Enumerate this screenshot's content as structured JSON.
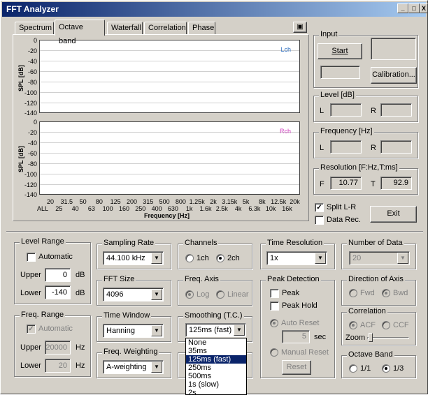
{
  "window": {
    "title": "FFT Analyzer",
    "min": "_",
    "max": "□",
    "close": "X"
  },
  "tabs": [
    "Spectrum",
    "Octave band",
    "Waterfall",
    "Correlation",
    "Phase"
  ],
  "plot": {
    "ylabel": "SPL [dB]",
    "yticks": [
      "0",
      "-20",
      "-40",
      "-60",
      "-80",
      "-100",
      "-120",
      "-140"
    ],
    "lch": "Lch",
    "rch": "Rch",
    "xticks_top": [
      "20",
      "31.5",
      "50",
      "80",
      "125",
      "200",
      "315",
      "500",
      "800",
      "1.25k",
      "2k",
      "3.15k",
      "5k",
      "8k",
      "12.5k",
      "20k"
    ],
    "xticks_bottom": [
      "ALL",
      "25",
      "40",
      "63",
      "100",
      "160",
      "250",
      "400",
      "630",
      "1k",
      "1.6k",
      "2.5k",
      "4k",
      "6.3k",
      "10k",
      "16k"
    ],
    "xlabel": "Frequency [Hz]"
  },
  "input": {
    "title": "Input",
    "start": "Start",
    "calibration": "Calibration..."
  },
  "level": {
    "title": "Level [dB]",
    "l": "L",
    "r": "R"
  },
  "frequency": {
    "title": "Frequency [Hz]",
    "l": "L",
    "r": "R"
  },
  "resolution": {
    "title": "Resolution [F:Hz,T:ms]",
    "f": "F",
    "f_val": "10.77",
    "t": "T",
    "t_val": "92.9"
  },
  "split": "Split L-R",
  "datarec": "Data Rec.",
  "exit": "Exit",
  "level_range": {
    "title": "Level Range",
    "automatic": "Automatic",
    "upper": "Upper",
    "upper_val": "0",
    "lower": "Lower",
    "lower_val": "-140",
    "unit": "dB"
  },
  "freq_range": {
    "title": "Freq. Range",
    "automatic": "Automatic",
    "upper": "Upper",
    "upper_val": "20000",
    "lower": "Lower",
    "lower_val": "20",
    "unit": "Hz"
  },
  "sampling": {
    "title": "Sampling Rate",
    "value": "44.100 kHz"
  },
  "fft_size": {
    "title": "FFT Size",
    "value": "4096"
  },
  "time_window": {
    "title": "Time Window",
    "value": "Hanning"
  },
  "freq_weighting": {
    "title": "Freq. Weighting",
    "value": "A-weighting"
  },
  "channels": {
    "title": "Channels",
    "opt1": "1ch",
    "opt2": "2ch"
  },
  "freq_axis": {
    "title": "Freq. Axis",
    "opt1": "Log",
    "opt2": "Linear"
  },
  "smoothing": {
    "title": "Smoothing (T.C.)",
    "value": "125ms (fast)",
    "options": [
      "None",
      "35ms",
      "125ms (fast)",
      "250ms",
      "500ms",
      "1s (slow)",
      "2s"
    ]
  },
  "time_res": {
    "title": "Time Resolution",
    "value": "1x"
  },
  "peak": {
    "title": "Peak Detection",
    "peak": "Peak",
    "hold": "Peak Hold",
    "auto": "Auto Reset",
    "sec_val": "5",
    "sec": "sec",
    "manual": "Manual Reset",
    "reset": "Reset"
  },
  "num_data": {
    "title": "Number of Data",
    "value": "20"
  },
  "direction": {
    "title": "Direction of Axis",
    "fwd": "Fwd",
    "bwd": "Bwd"
  },
  "correlation": {
    "title": "Correlation",
    "acf": "ACF",
    "ccf": "CCF",
    "zoom": "Zoom"
  },
  "octave": {
    "title": "Octave Band",
    "opt1": "1/1",
    "opt2": "1/3"
  },
  "colors": {
    "titlebar": "#0a246a",
    "lch": "#3070c0",
    "rch": "#d040c0",
    "bg": "#d4d0c8"
  }
}
